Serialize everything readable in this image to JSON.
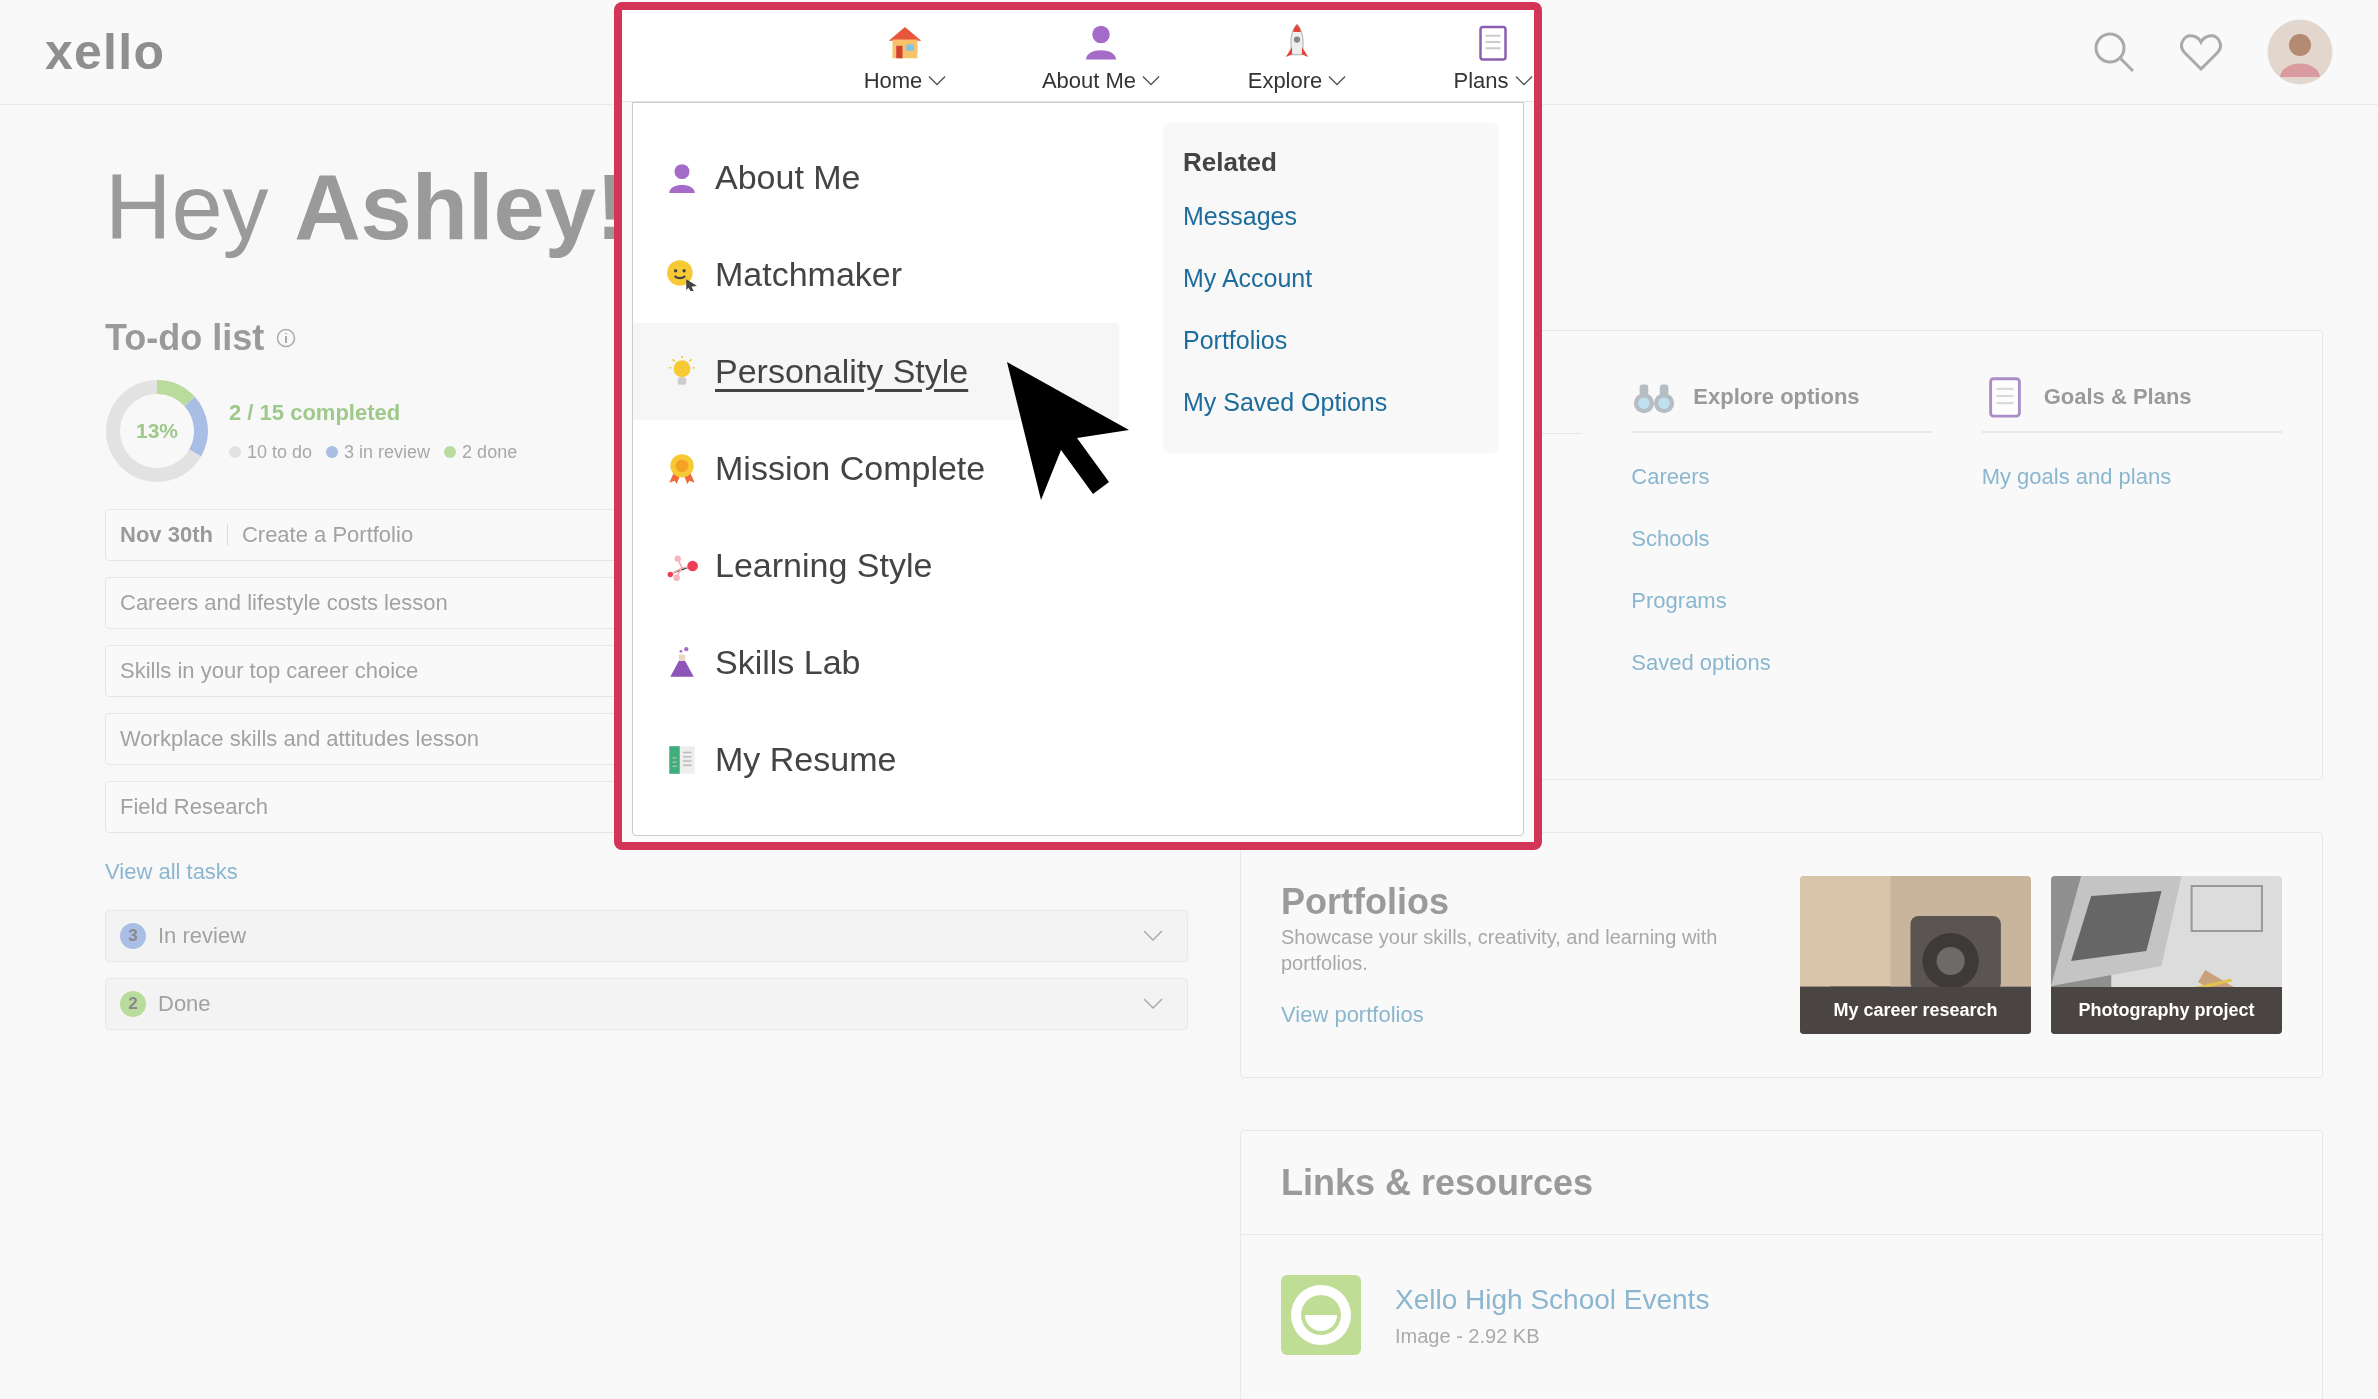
{
  "logo": "xello",
  "greeting": "Hey **Ashley!**",
  "todo": {
    "title": "To-do list",
    "percent": "13%",
    "summary": "2 / 15 completed",
    "chart_data": {
      "type": "donut",
      "categories": [
        "10 to do",
        "3 in review",
        "2 done"
      ],
      "values": [
        10,
        3,
        2
      ]
    },
    "legend": [
      {
        "color": "#e2e2e2"
      },
      {
        "color": "#a9bee4"
      },
      {
        "color": "#b9dc9c"
      }
    ],
    "tasks": [
      {
        "date": "Nov 30th",
        "title": "Create a Portfolio"
      },
      {
        "title": "Careers and lifestyle costs lesson"
      },
      {
        "title": "Skills in your top career choice"
      },
      {
        "title": "Workplace skills and attitudes lesson"
      },
      {
        "title": "Field Research"
      }
    ],
    "view_all": "View all tasks",
    "groups": [
      {
        "count": "3",
        "label": "In review",
        "color": "#a9bee4"
      },
      {
        "count": "2",
        "label": "Done",
        "color": "#b9dc9c"
      }
    ]
  },
  "sections": [
    {
      "kind": "binoculars",
      "title": "Explore options",
      "links": [
        "Careers",
        "Schools",
        "Programs",
        "Saved options"
      ]
    },
    {
      "kind": "clipboard",
      "title": "Goals & Plans",
      "links": [
        "My goals and plans"
      ]
    }
  ],
  "portfolios": {
    "title": "Portfolios",
    "description": "Showcase your skills, creativity, and learning with portfolios.",
    "link": "View portfolios",
    "items": [
      {
        "caption": "My career research",
        "kind": "picture"
      },
      {
        "caption": "Photography project",
        "kind": "picture"
      }
    ]
  },
  "resources": {
    "title": "Links & resources",
    "items": [
      {
        "title": "Xello High School Events",
        "meta": "Image - 2.92 KB"
      }
    ]
  },
  "overlay": {
    "nav": [
      {
        "kind": "house",
        "label": "Home"
      },
      {
        "kind": "person",
        "label": "About Me"
      },
      {
        "kind": "rocket",
        "label": "Explore"
      },
      {
        "kind": "clipboard",
        "label": "Plans"
      }
    ],
    "menu": [
      {
        "kind": "person",
        "label": "About Me",
        "selected": false
      },
      {
        "kind": "smiley",
        "label": "Matchmaker",
        "selected": false
      },
      {
        "kind": "bulb",
        "label": "Personality Style",
        "selected": true
      },
      {
        "kind": "medal",
        "label": "Mission Complete",
        "selected": false
      },
      {
        "kind": "dots",
        "label": "Learning Style",
        "selected": false
      },
      {
        "kind": "flask",
        "label": "Skills Lab",
        "selected": false
      },
      {
        "kind": "resume",
        "label": "My Resume",
        "selected": false
      }
    ],
    "related": {
      "title": "Related",
      "links": [
        "Messages",
        "My Account",
        "Portfolios",
        "My Saved Options"
      ]
    }
  }
}
